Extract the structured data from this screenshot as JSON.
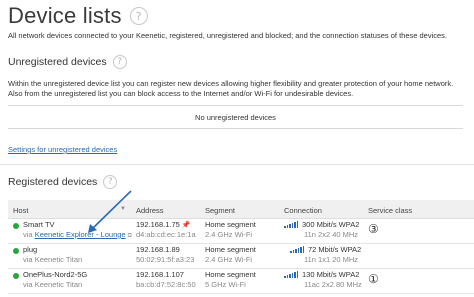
{
  "page": {
    "title": "Device lists",
    "description": "All network devices connected to your Keenetic, registered, unregistered and blocked; and the connection statuses of these devices."
  },
  "unregistered": {
    "title": "Unregistered devices",
    "description": "Within the unregistered device list you can register new devices allowing higher flexibility and greater protection of your home network. Also from the unregistered list you can block access to the Internet and/or Wi-Fi for undesirable devices.",
    "empty_text": "No unregistered devices",
    "settings_link": "Settings for unregistered devices"
  },
  "registered": {
    "title": "Registered devices",
    "columns": {
      "host": "Host",
      "address": "Address",
      "segment": "Segment",
      "connection": "Connection",
      "service_class": "Service class"
    },
    "rows": [
      {
        "name": "Smart TV",
        "via_prefix": "via",
        "via": "Keenetic Explorer - Lounge",
        "ip": "192.168.1.75",
        "mac": "d4:ab:cd:ec:1e:1a",
        "segment": "Home segment",
        "band": "2.4 GHz Wi-Fi",
        "speed": "300 Mbit/s WPA2",
        "mode": "11n 2x2 40 MHz",
        "service_class": "③",
        "signal": "full"
      },
      {
        "name": "plug",
        "via_prefix": "via",
        "via": "Keenetic Titan",
        "ip": "192.168.1.89",
        "mac": "50:02:91:5f:a3:23",
        "segment": "Home segment",
        "band": "2.4 GHz Wi-Fi",
        "speed": "72 Mbit/s WPA2",
        "mode": "11n 1x1 20 MHz",
        "service_class": "",
        "signal": "full"
      },
      {
        "name": "OnePlus-Nord2-5G",
        "via_prefix": "via",
        "via": "Keenetic Titan",
        "ip": "192.168.1.107",
        "mac": "ba:cb:d7:52:8c:50",
        "segment": "Home segment",
        "band": "5 GHz Wi-Fi",
        "speed": "130 Mbit/s WPA2",
        "mode": "11ac 2x2 80 MHz",
        "service_class": "①",
        "signal": "full"
      }
    ]
  },
  "icons": {
    "help": "question-circle-icon",
    "pin": "pin-icon",
    "external_link": "external-link-icon",
    "signal": "wifi-signal-icon",
    "status": "online-dot-icon"
  },
  "colors": {
    "link": "#2a6ab5",
    "online": "#2aa33b",
    "annotation_arrow": "#2a6ab5"
  }
}
